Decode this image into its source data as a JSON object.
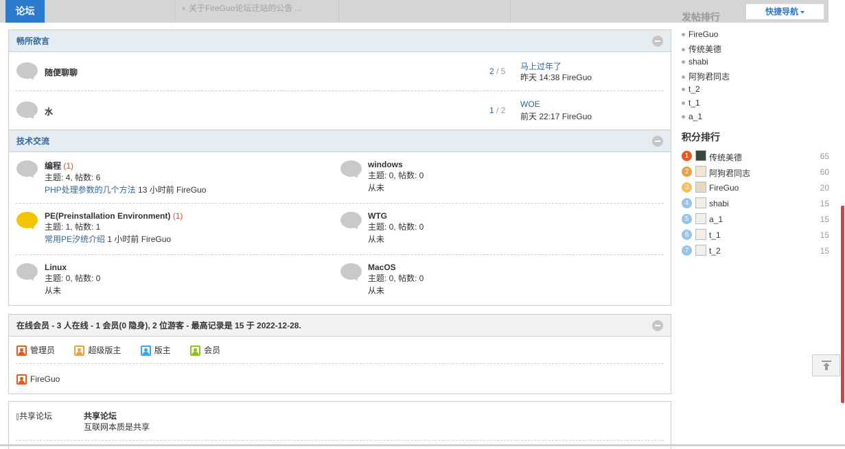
{
  "topbar": {
    "brand": "论坛",
    "notice": "关于FireGuo论坛迁站的公告 ...",
    "quicknav": "快捷导航"
  },
  "groups": [
    {
      "title": "畅所欲言",
      "forums": [
        {
          "name": "随便聊聊",
          "stats_a": "2",
          "stats_b": "5",
          "last_title": "马上过年了",
          "last_time": "昨天 14:38 FireGuo"
        },
        {
          "name": "水",
          "stats_a": "1",
          "stats_b": "2",
          "last_title": "WOE",
          "last_time": "前天 22:17 FireGuo"
        }
      ]
    },
    {
      "title": "技术交流",
      "forums": [
        {
          "name": "编程",
          "today": "(1)",
          "counts": "主题: 4, 帖数: 6",
          "last_link": "PHP处理参数的几个方法",
          "last_info": "13 小时前 FireGuo"
        },
        {
          "name": "windows",
          "today": "",
          "counts": "主题: 0, 帖数: 0",
          "last_info": "从未"
        },
        {
          "name": "PE(Preinstallation Environment)",
          "today": "(1)",
          "counts": "主题: 1, 帖数: 1",
          "last_link": "常用PE汐统介绍",
          "last_info": "1 小时前 FireGuo"
        },
        {
          "name": "WTG",
          "today": "",
          "counts": "主题: 0, 帖数: 0",
          "last_info": "从未"
        },
        {
          "name": "Linux",
          "today": "",
          "counts": "主题: 0, 帖数: 0",
          "last_info": "从未"
        },
        {
          "name": "MacOS",
          "today": "",
          "counts": "主题: 0, 帖数: 0",
          "last_info": "从未"
        }
      ]
    }
  ],
  "online": {
    "title": "在线会员 - 3 人在线 - 1 会员(0 隐身), 2 位游客 - 最高记录是 15 于 2022-12-28.",
    "legend": [
      {
        "label": "管理员",
        "color": "#e9591f"
      },
      {
        "label": "超级版主",
        "color": "#f0a23a"
      },
      {
        "label": "版主",
        "color": "#3ea3e4"
      },
      {
        "label": "会员",
        "color": "#8cc21c"
      }
    ],
    "member": "FireGuo"
  },
  "links": {
    "logo_alt": "共享论坛",
    "name": "共享论坛",
    "desc": "互联网本质是共享"
  },
  "sidebar": {
    "post_rank_title": "发帖排行",
    "post_rank": [
      "FireGuo",
      "传统美德",
      "shabi",
      "阿狗君同志",
      "t_2",
      "t_1",
      "a_1"
    ],
    "score_rank_title": "积分排行",
    "score_rank": [
      {
        "num": "1",
        "name": "传统美德",
        "score": "65",
        "color": "#e9591f"
      },
      {
        "num": "2",
        "name": "阿狗君同志",
        "score": "60",
        "color": "#f0a23a"
      },
      {
        "num": "3",
        "name": "FireGuo",
        "score": "20",
        "color": "#f5c15b"
      },
      {
        "num": "4",
        "name": "shabi",
        "score": "15",
        "color": "#97c4e8"
      },
      {
        "num": "5",
        "name": "a_1",
        "score": "15",
        "color": "#97c4e8"
      },
      {
        "num": "6",
        "name": "t_1",
        "score": "15",
        "color": "#97c4e8"
      },
      {
        "num": "7",
        "name": "t_2",
        "score": "15",
        "color": "#97c4e8"
      }
    ]
  }
}
